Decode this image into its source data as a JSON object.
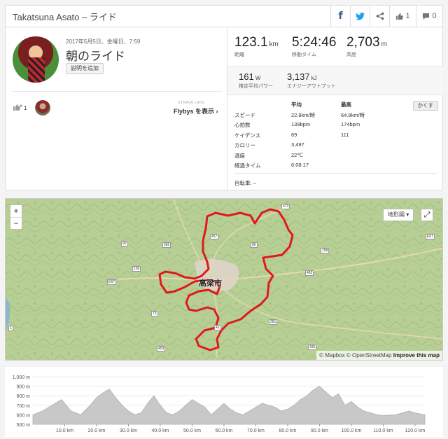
{
  "header": {
    "title": "Takatsuna Asato – ライド",
    "kudos_count": "1",
    "comments_count": "0"
  },
  "activity": {
    "datetime": "2017年5月5日、金曜日、7:59",
    "name": "朝のライド",
    "add_description": "説明を追加",
    "kudos": "1",
    "labs": "STRAVA LABS",
    "flybys": "Flybys を表示"
  },
  "stats": {
    "distance": {
      "value": "123.1",
      "unit": "km",
      "label": "距離"
    },
    "moving_time": {
      "value": "5:24:46",
      "label": "移動タイム"
    },
    "elevation": {
      "value": "2,703",
      "unit": "m",
      "label": "高度"
    },
    "power": {
      "value": "161",
      "unit": "W",
      "label": "推定平均パワー"
    },
    "energy": {
      "value": "3,137",
      "unit": "kJ",
      "label": "エナジーアウトプット"
    }
  },
  "table": {
    "headers": [
      "",
      "平均",
      "最高"
    ],
    "rows": [
      [
        "スピード",
        "22.8km/時",
        "64.8km/時"
      ],
      [
        "心拍数",
        "139bpm",
        "174bpm"
      ],
      [
        "ケイデンス",
        "69",
        "111"
      ],
      [
        "カロリー",
        "3,497",
        ""
      ],
      [
        "温度",
        "22℃",
        ""
      ],
      [
        "経過タイム",
        "6:08:17",
        ""
      ]
    ],
    "hide_button": "かくす",
    "bike": "自転車: –"
  },
  "map": {
    "zoom_in": "+",
    "zoom_out": "−",
    "mode": "地形図 ▾",
    "place": "高梁市",
    "attribution_prefix": "© Mapbox © OpenStreetMap",
    "attribution_link": "Improve this map",
    "route_color": "#e0191b",
    "road_labels": [
      "473",
      "457",
      "80",
      "682",
      "90",
      "156",
      "E67",
      "158",
      "462",
      "361",
      "41",
      "73",
      "453",
      "435",
      "E67",
      "1"
    ]
  },
  "chart_data": {
    "type": "area",
    "title": "",
    "xlabel": "",
    "ylabel": "",
    "x_ticks": [
      "10.0 km",
      "20.0 km",
      "30.0 km",
      "40.0 km",
      "50.0 km",
      "60.0 km",
      "70.0 km",
      "80.0 km",
      "90.0 km",
      "100.0 km",
      "110.0 km",
      "120.0 km"
    ],
    "y_ticks": [
      "1,000 m",
      "900 m",
      "800 m",
      "700 m",
      "600 m",
      "500 m"
    ],
    "ylim": [
      500,
      1000
    ],
    "xlim": [
      0,
      123.1
    ],
    "fill_color": "#c8c8c8",
    "x": [
      0,
      3,
      6,
      9,
      12,
      15,
      18,
      20,
      22,
      24,
      26,
      28,
      30,
      32,
      34,
      36,
      38,
      40,
      42,
      44,
      46,
      48,
      50,
      52,
      54,
      56,
      58,
      60,
      62,
      64,
      66,
      68,
      70,
      72,
      74,
      76,
      78,
      80,
      82,
      84,
      86,
      88,
      90,
      92,
      94,
      96,
      98,
      100,
      102,
      104,
      106,
      108,
      110,
      112,
      114,
      116,
      118,
      120,
      123.1
    ],
    "y": [
      600,
      640,
      700,
      760,
      640,
      600,
      700,
      780,
      830,
      870,
      780,
      700,
      640,
      600,
      620,
      720,
      800,
      700,
      620,
      600,
      640,
      700,
      760,
      720,
      680,
      600,
      660,
      720,
      660,
      620,
      600,
      640,
      680,
      720,
      700,
      680,
      640,
      660,
      700,
      760,
      800,
      860,
      900,
      840,
      780,
      820,
      700,
      740,
      680,
      640,
      620,
      600,
      590,
      595,
      600,
      620,
      640,
      620,
      600
    ]
  }
}
